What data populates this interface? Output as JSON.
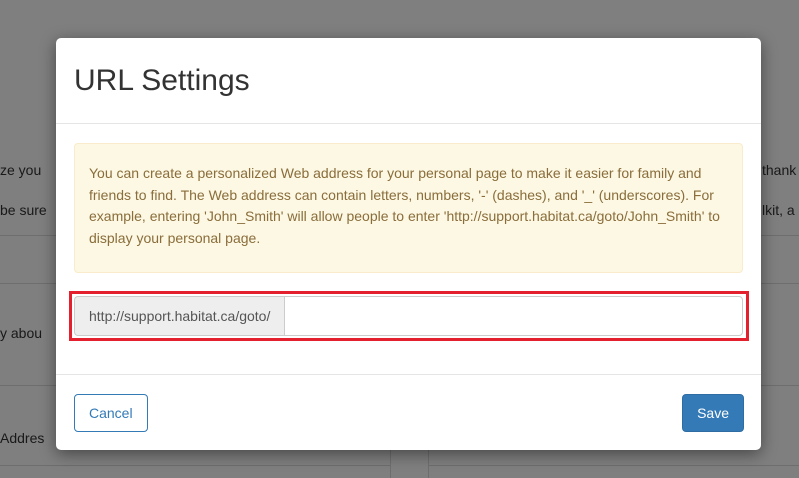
{
  "background": {
    "fragments": {
      "left_ze_you": "ze you",
      "left_be_sure": "be sure",
      "left_y_about": "y abou",
      "left_address": "Addres",
      "right_thank": "thank",
      "right_kit_a": "lkit, a"
    }
  },
  "modal": {
    "title": "URL Settings",
    "info_text": "You can create a personalized Web address for your personal page to make it easier for family and friends to find. The Web address can contain letters, numbers, '-' (dashes), and '_' (underscores). For example, entering 'John_Smith' will allow people to enter 'http://support.habitat.ca/goto/John_Smith' to display your personal page.",
    "url_prefix": "http://support.habitat.ca/goto/",
    "url_value": "",
    "url_placeholder": "",
    "cancel_label": "Cancel",
    "save_label": "Save"
  },
  "colors": {
    "primary": "#337ab7",
    "alert_bg": "#fcf8e3",
    "alert_text": "#8a6d3b",
    "highlight": "#e5202e"
  }
}
